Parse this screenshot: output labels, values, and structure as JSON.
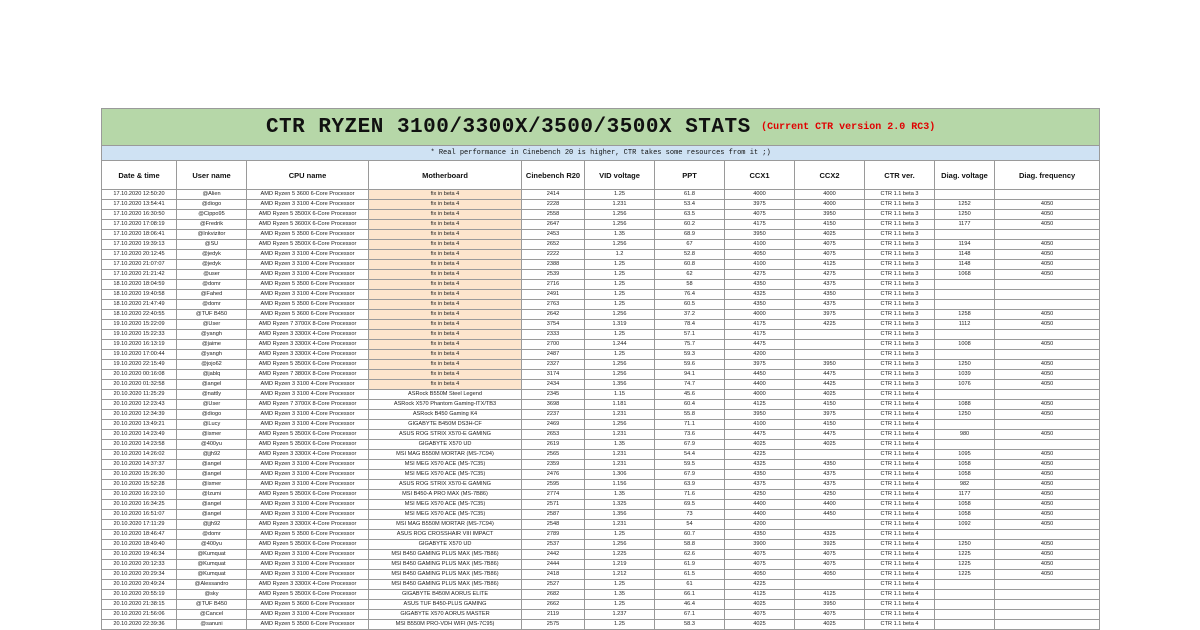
{
  "title": {
    "main": "CTR RYZEN 3100/3300X/3500/3500X STATS",
    "sub": "(Current CTR version 2.0 RC3)"
  },
  "note": "* Real performance in Cinebench 20 is higher, CTR takes some resources from it ;)",
  "colors": {
    "title_bg": "#b6d7a8",
    "note_bg": "#cfe2f3",
    "beta_bg": "#fce5cd",
    "sub_red": "#e00000"
  },
  "columns": [
    "Date & time",
    "User name",
    "CPU name",
    "Motherboard",
    "Cinebench R20",
    "VID voltage",
    "PPT",
    "CCX1",
    "CCX2",
    "CTR ver.",
    "Diag. voltage",
    "Diag. frequency"
  ],
  "rows": [
    [
      "17.10.2020 12:50:20",
      "@Alien",
      "AMD Ryzen 5 3600 6-Core Processor",
      "fix in beta 4",
      "2414",
      "1.25",
      "61.8",
      "4000",
      "4000",
      "CTR 1.1 beta 3",
      "",
      ""
    ],
    [
      "17.10.2020 13:54:41",
      "@diogo",
      "AMD Ryzen 3 3100 4-Core Processor",
      "fix in beta 4",
      "2228",
      "1.231",
      "53.4",
      "3975",
      "4000",
      "CTR 1.1 beta 3",
      "1252",
      "4050"
    ],
    [
      "17.10.2020 16:30:50",
      "@Cippo95",
      "AMD Ryzen 5 3500X 6-Core Processor",
      "fix in beta 4",
      "2558",
      "1.256",
      "63.5",
      "4075",
      "3950",
      "CTR 1.1 beta 3",
      "1250",
      "4050"
    ],
    [
      "17.10.2020 17:08:19",
      "@Fredrik",
      "AMD Ryzen 5 3600X 6-Core Processor",
      "fix in beta 4",
      "2647",
      "1.256",
      "60.2",
      "4175",
      "4150",
      "CTR 1.1 beta 3",
      "1177",
      "4050"
    ],
    [
      "17.10.2020 18:06:41",
      "@Inkvizitor",
      "AMD Ryzen 5 3500 6-Core Processor",
      "fix in beta 4",
      "2453",
      "1.35",
      "68.9",
      "3950",
      "4025",
      "CTR 1.1 beta 3",
      "",
      ""
    ],
    [
      "17.10.2020 19:39:13",
      "@SU",
      "AMD Ryzen 5 3500X 6-Core Processor",
      "fix in beta 4",
      "2652",
      "1.256",
      "67",
      "4100",
      "4075",
      "CTR 1.1 beta 3",
      "1194",
      "4050"
    ],
    [
      "17.10.2020 20:12:45",
      "@jedyk",
      "AMD Ryzen 3 3100 4-Core Processor",
      "fix in beta 4",
      "2222",
      "1.2",
      "52.8",
      "4050",
      "4075",
      "CTR 1.1 beta 3",
      "1148",
      "4050"
    ],
    [
      "17.10.2020 21:07:07",
      "@jedyk",
      "AMD Ryzen 3 3100 4-Core Processor",
      "fix in beta 4",
      "2388",
      "1.25",
      "60.8",
      "4100",
      "4125",
      "CTR 1.1 beta 3",
      "1148",
      "4050"
    ],
    [
      "17.10.2020 21:21:42",
      "@user",
      "AMD Ryzen 3 3100 4-Core Processor",
      "fix in beta 4",
      "2539",
      "1.25",
      "62",
      "4275",
      "4275",
      "CTR 1.1 beta 3",
      "1068",
      "4050"
    ],
    [
      "18.10.2020 18:04:59",
      "@domr",
      "AMD Ryzen 5 3500 6-Core Processor",
      "fix in beta 4",
      "2716",
      "1.25",
      "58",
      "4350",
      "4375",
      "CTR 1.1 beta 3",
      "",
      ""
    ],
    [
      "18.10.2020 19:40:58",
      "@Fahed",
      "AMD Ryzen 3 3100 4-Core Processor",
      "fix in beta 4",
      "2491",
      "1.25",
      "76.4",
      "4325",
      "4350",
      "CTR 1.1 beta 3",
      "",
      ""
    ],
    [
      "18.10.2020 21:47:49",
      "@domr",
      "AMD Ryzen 5 3500 6-Core Processor",
      "fix in beta 4",
      "2763",
      "1.25",
      "60.5",
      "4350",
      "4375",
      "CTR 1.1 beta 3",
      "",
      ""
    ],
    [
      "18.10.2020 22:40:55",
      "@TUF B450",
      "AMD Ryzen 5 3600 6-Core Processor",
      "fix in beta 4",
      "2642",
      "1.256",
      "37.2",
      "4000",
      "3975",
      "CTR 1.1 beta 3",
      "1258",
      "4050"
    ],
    [
      "19.10.2020 15:22:09",
      "@User",
      "AMD Ryzen 7 3700X 8-Core Processor",
      "fix in beta 4",
      "3754",
      "1.319",
      "78.4",
      "4175",
      "4225",
      "CTR 1.1 beta 3",
      "1112",
      "4050"
    ],
    [
      "19.10.2020 15:22:33",
      "@yangh",
      "AMD Ryzen 3 3300X 4-Core Processor",
      "fix in beta 4",
      "2333",
      "1.25",
      "57.1",
      "4175",
      "",
      "CTR 1.1 beta 3",
      "",
      ""
    ],
    [
      "19.10.2020 16:13:19",
      "@jaime",
      "AMD Ryzen 3 3300X 4-Core Processor",
      "fix in beta 4",
      "2700",
      "1.244",
      "75.7",
      "4475",
      "",
      "CTR 1.1 beta 3",
      "1008",
      "4050"
    ],
    [
      "19.10.2020 17:00:44",
      "@yangh",
      "AMD Ryzen 3 3300X 4-Core Processor",
      "fix in beta 4",
      "2487",
      "1.25",
      "59.3",
      "4200",
      "",
      "CTR 1.1 beta 3",
      "",
      ""
    ],
    [
      "19.10.2020 22:15:49",
      "@jojo62",
      "AMD Ryzen 5 3500X 6-Core Processor",
      "fix in beta 4",
      "2327",
      "1.256",
      "59.6",
      "3975",
      "3950",
      "CTR 1.1 beta 3",
      "1250",
      "4050"
    ],
    [
      "20.10.2020 00:16:08",
      "@jablq",
      "AMD Ryzen 7 3800X 8-Core Processor",
      "fix in beta 4",
      "3174",
      "1.256",
      "94.1",
      "4450",
      "4475",
      "CTR 1.1 beta 3",
      "1039",
      "4050"
    ],
    [
      "20.10.2020 01:32:58",
      "@angel",
      "AMD Ryzen 3 3100 4-Core Processor",
      "fix in beta 4",
      "2434",
      "1.356",
      "74.7",
      "4400",
      "4425",
      "CTR 1.1 beta 3",
      "1076",
      "4050"
    ],
    [
      "20.10.2020 11:25:29",
      "@nattly",
      "AMD Ryzen 3 3100 4-Core Processor",
      "ASRock B550M Steel Legend",
      "2345",
      "1.15",
      "45.6",
      "4000",
      "4025",
      "CTR 1.1 beta 4",
      "",
      ""
    ],
    [
      "20.10.2020 12:23:43",
      "@User",
      "AMD Ryzen 7 3700X 8-Core Processor",
      "ASRock X570 Phantom Gaming-ITX/TB3",
      "3698",
      "1.181",
      "60.4",
      "4125",
      "4150",
      "CTR 1.1 beta 4",
      "1088",
      "4050"
    ],
    [
      "20.10.2020 12:34:39",
      "@diogo",
      "AMD Ryzen 3 3100 4-Core Processor",
      "ASRock B450 Gaming K4",
      "2237",
      "1.231",
      "55.8",
      "3950",
      "3975",
      "CTR 1.1 beta 4",
      "1250",
      "4050"
    ],
    [
      "20.10.2020 13:49:21",
      "@Lucy",
      "AMD Ryzen 3 3100 4-Core Processor",
      "GIGABYTE B450M DS3H-CF",
      "2469",
      "1.256",
      "71.1",
      "4100",
      "4150",
      "CTR 1.1 beta 4",
      "",
      ""
    ],
    [
      "20.10.2020 14:23:49",
      "@ismer",
      "AMD Ryzen 5 3500X 6-Core Processor",
      "ASUS ROG STRIX X570-E GAMING",
      "2653",
      "1.231",
      "73.6",
      "4475",
      "4475",
      "CTR 1.1 beta 4",
      "980",
      "4050"
    ],
    [
      "20.10.2020 14:23:58",
      "@400yu",
      "AMD Ryzen 5 3500X 6-Core Processor",
      "GIGABYTE X570 UD",
      "2619",
      "1.35",
      "67.9",
      "4025",
      "4025",
      "CTR 1.1 beta 4",
      "",
      ""
    ],
    [
      "20.10.2020 14:26:02",
      "@jjh92",
      "AMD Ryzen 3 3300X 4-Core Processor",
      "MSI MAG B550M MORTAR (MS-7C94)",
      "2565",
      "1.231",
      "54.4",
      "4225",
      "",
      "CTR 1.1 beta 4",
      "1095",
      "4050"
    ],
    [
      "20.10.2020 14:37:37",
      "@angel",
      "AMD Ryzen 3 3100 4-Core Processor",
      "MSI MEG X570 ACE (MS-7C35)",
      "2359",
      "1.231",
      "59.5",
      "4325",
      "4350",
      "CTR 1.1 beta 4",
      "1058",
      "4050"
    ],
    [
      "20.10.2020 15:26:30",
      "@angel",
      "AMD Ryzen 3 3100 4-Core Processor",
      "MSI MEG X570 ACE (MS-7C35)",
      "2476",
      "1.306",
      "67.9",
      "4350",
      "4375",
      "CTR 1.1 beta 4",
      "1058",
      "4050"
    ],
    [
      "20.10.2020 15:52:28",
      "@ismer",
      "AMD Ryzen 3 3100 4-Core Processor",
      "ASUS ROG STRIX X570-E GAMING",
      "2595",
      "1.156",
      "63.9",
      "4375",
      "4375",
      "CTR 1.1 beta 4",
      "982",
      "4050"
    ],
    [
      "20.10.2020 16:23:10",
      "@Izumi",
      "AMD Ryzen 5 3500X 6-Core Processor",
      "MSI B450-A PRO MAX (MS-7B86)",
      "2774",
      "1.35",
      "71.6",
      "4250",
      "4250",
      "CTR 1.1 beta 4",
      "1177",
      "4050"
    ],
    [
      "20.10.2020 16:34:25",
      "@angel",
      "AMD Ryzen 3 3100 4-Core Processor",
      "MSI MEG X570 ACE (MS-7C35)",
      "2571",
      "1.325",
      "69.5",
      "4400",
      "4400",
      "CTR 1.1 beta 4",
      "1058",
      "4050"
    ],
    [
      "20.10.2020 16:51:07",
      "@angel",
      "AMD Ryzen 3 3100 4-Core Processor",
      "MSI MEG X570 ACE (MS-7C35)",
      "2587",
      "1.356",
      "73",
      "4400",
      "4450",
      "CTR 1.1 beta 4",
      "1058",
      "4050"
    ],
    [
      "20.10.2020 17:11:29",
      "@jjh92",
      "AMD Ryzen 3 3300X 4-Core Processor",
      "MSI MAG B550M MORTAR (MS-7C94)",
      "2548",
      "1.231",
      "54",
      "4200",
      "",
      "CTR 1.1 beta 4",
      "1092",
      "4050"
    ],
    [
      "20.10.2020 18:46:47",
      "@domr",
      "AMD Ryzen 5 3500 6-Core Processor",
      "ASUS ROG CROSSHAIR VIII IMPACT",
      "2789",
      "1.25",
      "60.7",
      "4350",
      "4325",
      "CTR 1.1 beta 4",
      "",
      ""
    ],
    [
      "20.10.2020 18:49:40",
      "@400yu",
      "AMD Ryzen 5 3500X 6-Core Processor",
      "GIGABYTE X570 UD",
      "2537",
      "1.256",
      "58.8",
      "3900",
      "3925",
      "CTR 1.1 beta 4",
      "1250",
      "4050"
    ],
    [
      "20.10.2020 19:46:34",
      "@Kumquat",
      "AMD Ryzen 3 3100 4-Core Processor",
      "MSI B450 GAMING PLUS MAX (MS-7B86)",
      "2442",
      "1.225",
      "62.6",
      "4075",
      "4075",
      "CTR 1.1 beta 4",
      "1225",
      "4050"
    ],
    [
      "20.10.2020 20:12:33",
      "@Kumquat",
      "AMD Ryzen 3 3100 4-Core Processor",
      "MSI B450 GAMING PLUS MAX (MS-7B86)",
      "2444",
      "1.219",
      "61.9",
      "4075",
      "4075",
      "CTR 1.1 beta 4",
      "1225",
      "4050"
    ],
    [
      "20.10.2020 20:29:34",
      "@Kumquat",
      "AMD Ryzen 3 3100 4-Core Processor",
      "MSI B450 GAMING PLUS MAX (MS-7B86)",
      "2418",
      "1.212",
      "61.5",
      "4050",
      "4050",
      "CTR 1.1 beta 4",
      "1225",
      "4050"
    ],
    [
      "20.10.2020 20:49:24",
      "@Alessandro",
      "AMD Ryzen 3 3300X 4-Core Processor",
      "MSI B450 GAMING PLUS MAX (MS-7B86)",
      "2527",
      "1.25",
      "61",
      "4225",
      "",
      "CTR 1.1 beta 4",
      "",
      ""
    ],
    [
      "20.10.2020 20:55:19",
      "@sky",
      "AMD Ryzen 5 3500X 6-Core Processor",
      "GIGABYTE B450M AORUS ELITE",
      "2682",
      "1.35",
      "66.1",
      "4125",
      "4125",
      "CTR 1.1 beta 4",
      "",
      ""
    ],
    [
      "20.10.2020 21:38:15",
      "@TUF B450",
      "AMD Ryzen 5 3600 6-Core Processor",
      "ASUS TUF B450-PLUS GAMING",
      "2662",
      "1.25",
      "46.4",
      "4025",
      "3950",
      "CTR 1.1 beta 4",
      "",
      ""
    ],
    [
      "20.10.2020 21:56:06",
      "@Cancel",
      "AMD Ryzen 3 3100 4-Core Processor",
      "GIGABYTE X570 AORUS MASTER",
      "2119",
      "1.237",
      "67.1",
      "4075",
      "4075",
      "CTR 1.1 beta 4",
      "",
      ""
    ],
    [
      "20.10.2020 22:39:36",
      "@sanuni",
      "AMD Ryzen 5 3500 6-Core Processor",
      "MSI B550M PRO-VDH WIFI (MS-7C95)",
      "2575",
      "1.25",
      "58.3",
      "4025",
      "4025",
      "CTR 1.1 beta 4",
      "",
      ""
    ]
  ]
}
